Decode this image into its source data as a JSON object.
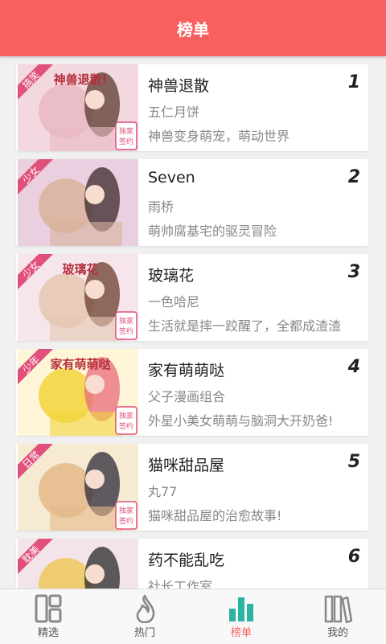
{
  "header": {
    "title": "榜单"
  },
  "items": [
    {
      "rank": "1",
      "title": "神兽退散",
      "author": "五仁月饼",
      "desc": "神兽变身萌宠，萌动世界",
      "tag": "搞笑",
      "cover_title": "神兽退散!",
      "badge": "独家签约",
      "colors": [
        "#f3d9df",
        "#e8b7c3",
        "#5a3a2e"
      ]
    },
    {
      "rank": "2",
      "title": "Seven",
      "author": "雨桥",
      "desc": "萌帅腐基宅的驱灵冒险",
      "tag": "少女",
      "cover_title": "",
      "badge": "",
      "colors": [
        "#e9cfe0",
        "#d9b39b",
        "#3b2a2a"
      ]
    },
    {
      "rank": "3",
      "title": "玻璃花",
      "author": "一色哈尼",
      "desc": "生活就是摔一跤醒了，全都成渣渣",
      "tag": "少女",
      "cover_title": "玻璃花",
      "badge": "独家签约",
      "colors": [
        "#f6e6ec",
        "#e6c6b0",
        "#6b3d2e"
      ]
    },
    {
      "rank": "4",
      "title": "家有萌萌哒",
      "author": "父子漫画组合",
      "desc": "外星小美女萌萌与脑洞大开奶爸!",
      "tag": "少年",
      "cover_title": "家有萌萌哒",
      "badge": "独家签约",
      "colors": [
        "#fff5d9",
        "#f2d33a",
        "#e86b7a"
      ]
    },
    {
      "rank": "5",
      "title": "猫咪甜品屋",
      "author": "丸77",
      "desc": "猫咪甜品屋的治愈故事!",
      "tag": "日常",
      "cover_title": "",
      "badge": "独家签约",
      "colors": [
        "#f7ead2",
        "#e4b98a",
        "#2c2a3a"
      ]
    },
    {
      "rank": "6",
      "title": "药不能乱吃",
      "author": "社长工作室",
      "desc": "",
      "tag": "耽美",
      "cover_title": "",
      "badge": "",
      "colors": [
        "#f2e4ea",
        "#f0c85a",
        "#2a2a2a"
      ]
    }
  ],
  "tabs": [
    {
      "label": "精选",
      "icon": "grid-icon",
      "active": false
    },
    {
      "label": "热门",
      "icon": "flame-icon",
      "active": false
    },
    {
      "label": "榜单",
      "icon": "bar-chart-icon",
      "active": true
    },
    {
      "label": "我的",
      "icon": "bookshelf-icon",
      "active": false
    }
  ],
  "colors": {
    "accent": "#f7605f",
    "tab_active": "#2bb3a3",
    "tab_inactive": "#888888"
  }
}
